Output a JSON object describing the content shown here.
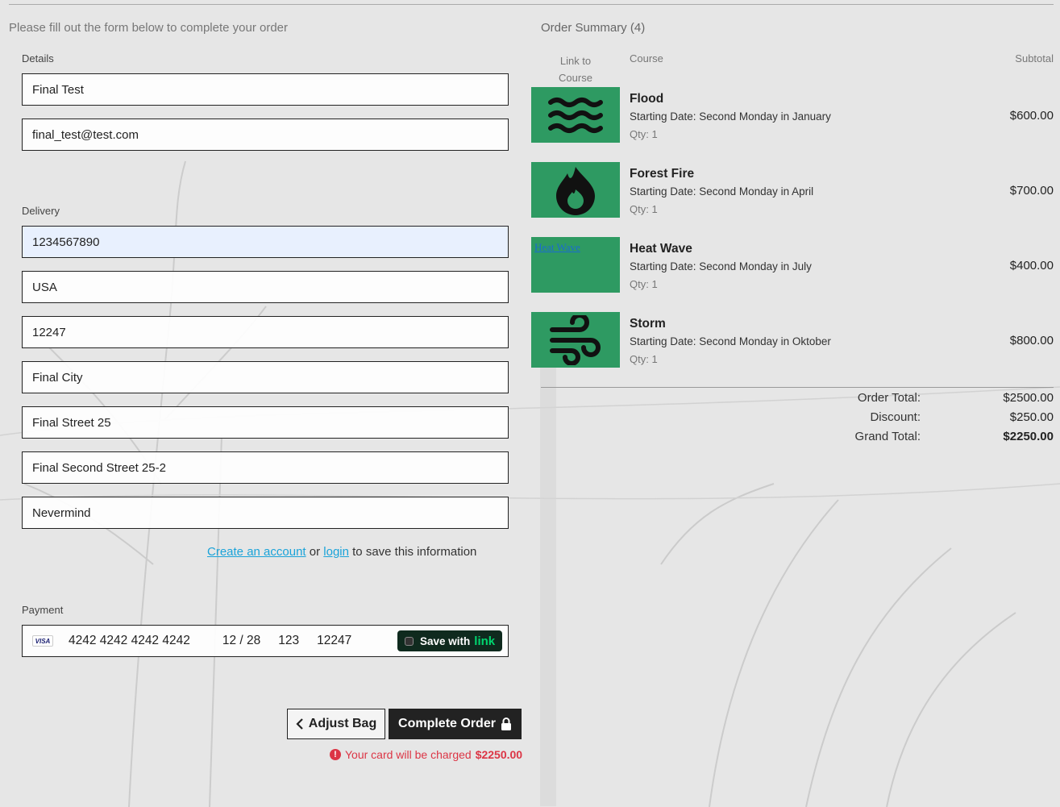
{
  "intro_text": "Please fill out the form below to complete your order",
  "details": {
    "label": "Details",
    "full_name": "Final Test",
    "email": "final_test@test.com"
  },
  "delivery": {
    "label": "Delivery",
    "phone": "1234567890",
    "country": "USA",
    "postcode": "12247",
    "town": "Final City",
    "street1": "Final Street 25",
    "street2": "Final Second Street 25-2",
    "county": "Nevermind"
  },
  "account": {
    "create_link": "Create an account",
    "or_text": "or",
    "login_link": "login",
    "suffix": "to save this information"
  },
  "payment": {
    "label": "Payment",
    "card_brand": "VISA",
    "card_number": "4242 4242 4242 4242",
    "expiry": "12 / 28",
    "cvc": "123",
    "zip": "12247",
    "link_save_text": "Save with",
    "link_brand": "link"
  },
  "buttons": {
    "adjust_bag": "Adjust Bag",
    "complete_order": "Complete Order"
  },
  "charge_note": {
    "text": "Your card will be charged",
    "amount": "$2250.00"
  },
  "summary": {
    "title": "Order Summary (4)",
    "col_link": "Link to Course",
    "col_course": "Course",
    "col_subtotal": "Subtotal",
    "items": [
      {
        "name": "Flood",
        "date": "Starting Date: Second Monday in January",
        "qty": "Qty: 1",
        "price": "$600.00",
        "icon": "water-waves-icon"
      },
      {
        "name": "Forest Fire",
        "date": "Starting Date: Second Monday in April",
        "qty": "Qty: 1",
        "price": "$700.00",
        "icon": "fire-icon"
      },
      {
        "name": "Heat Wave",
        "date": "Starting Date: Second Monday in July",
        "qty": "Qty: 1",
        "price": "$400.00",
        "icon": "broken-image-icon",
        "alt": "Heat Wave"
      },
      {
        "name": "Storm",
        "date": "Starting Date: Second Monday in Oktober",
        "qty": "Qty: 1",
        "price": "$800.00",
        "icon": "wind-icon"
      }
    ],
    "order_total_label": "Order Total:",
    "order_total": "$2500.00",
    "discount_label": "Discount:",
    "discount": "$250.00",
    "grand_total_label": "Grand Total:",
    "grand_total": "$2250.00"
  },
  "colors": {
    "thumb_green": "#2e9a62",
    "error_red": "#dc3545",
    "link_blue": "#1aa3d9",
    "dark_button": "#222222"
  }
}
